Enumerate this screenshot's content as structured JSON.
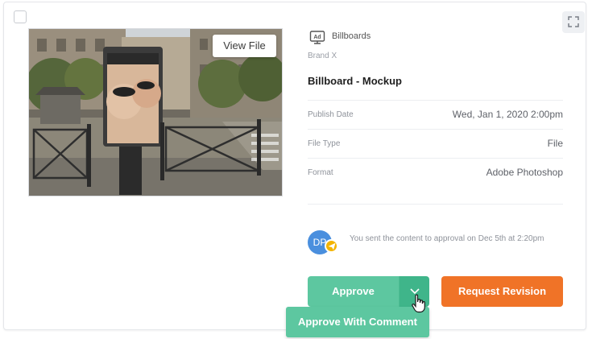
{
  "card": {
    "view_file_label": "View File",
    "content_type": "Billboards",
    "content_type_icon": "ad-icon",
    "brand": "Brand X",
    "title": "Billboard - Mockup",
    "fields": [
      {
        "label": "Publish Date",
        "value": "Wed, Jan 1, 2020 2:00pm"
      },
      {
        "label": "File Type",
        "value": "File"
      },
      {
        "label": "Format",
        "value": "Adobe Photoshop"
      }
    ],
    "approval": {
      "avatar_initials": "DP",
      "message": "You sent the content to approval on Dec 5th at 2:20pm"
    },
    "actions": {
      "approve_label": "Approve",
      "request_revision_label": "Request Revision",
      "approve_with_comment_label": "Approve With Comment"
    }
  },
  "colors": {
    "approve": "#5dc7a0",
    "approve_dropdown": "#3fb58a",
    "revision": "#f07327",
    "avatar": "#4a8fde",
    "send_badge": "#f4b400"
  }
}
